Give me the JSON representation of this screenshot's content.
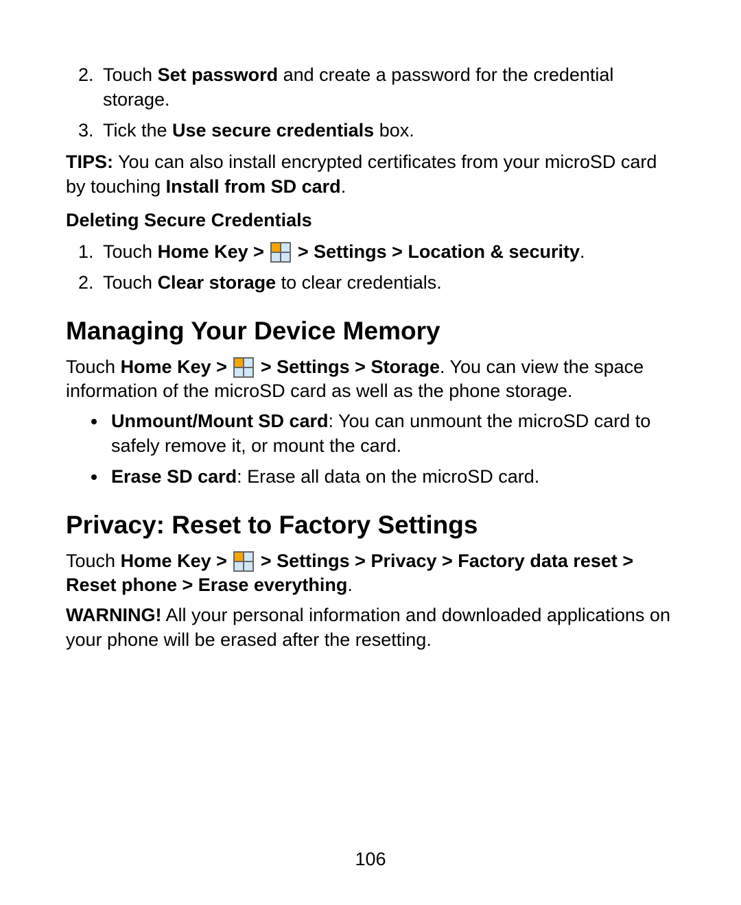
{
  "step2_prefix": "Touch ",
  "step2_bold": "Set password",
  "step2_suffix": " and create a password for the credential storage.",
  "step3_prefix": "Tick the ",
  "step3_bold": "Use secure credentials",
  "step3_suffix": " box.",
  "tips_label": "TIPS:",
  "tips_text": " You can also install encrypted certificates from your microSD card by touching ",
  "tips_bold": "Install from SD card",
  "tips_end": ".",
  "del_heading": "Deleting Secure Credentials",
  "del1_a": "Touch ",
  "del1_b": "Home Key > ",
  "del1_c": " > Settings > Location & security",
  "del1_d": ".",
  "del2_a": "Touch ",
  "del2_b": "Clear storage",
  "del2_c": " to clear credentials.",
  "memory_heading": "Managing Your Device Memory",
  "mem_a": "Touch ",
  "mem_b": "Home Key > ",
  "mem_c": " > Settings > Storage",
  "mem_d": ". You can view the space information of the microSD card as well as the phone storage.",
  "bul1_bold": "Unmount/Mount SD card",
  "bul1_rest": ": You can unmount the microSD card to safely remove it, or mount the card.",
  "bul2_bold": "Erase SD card",
  "bul2_rest": ": Erase all data on the microSD card.",
  "privacy_heading": "Privacy: Reset to Factory Settings",
  "priv_a": "Touch ",
  "priv_b": "Home Key > ",
  "priv_c": " > Settings > Privacy > Factory data reset > Reset phone > Erase everything",
  "priv_d": ".",
  "warn_label": "WARNING!",
  "warn_text": " All your personal information and downloaded applications on your phone will be erased after the resetting.",
  "page_number": "106"
}
